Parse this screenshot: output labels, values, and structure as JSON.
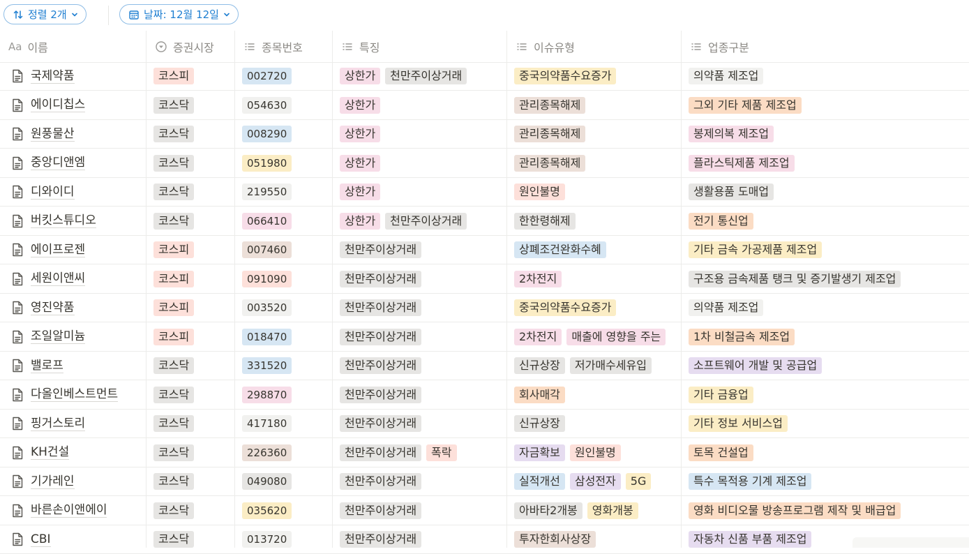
{
  "toolbar": {
    "sort_label": "정렬 2개",
    "date_label": "날짜: 12월 12일",
    "accent": "#1f7fd1",
    "sort_icon": "sort-arrows-icon",
    "date_icon": "calendar-icon"
  },
  "columns": {
    "name": "이름",
    "name_icon_text": "Aa",
    "market": "증권시장",
    "code": "종목번호",
    "feature": "특징",
    "issue": "이슈유형",
    "industry": "업종구분"
  },
  "rows": [
    {
      "name": "국제약품",
      "market": {
        "label": "코스피",
        "color": "red"
      },
      "code": {
        "label": "002720",
        "color": "blue"
      },
      "features": [
        {
          "label": "상한가",
          "color": "pink"
        },
        {
          "label": "천만주이상거래",
          "color": "gray"
        }
      ],
      "issues": [
        {
          "label": "중국의약품수요증가",
          "color": "yellow"
        }
      ],
      "industry": {
        "label": "의약품 제조업",
        "color": "default"
      }
    },
    {
      "name": "에이디칩스",
      "market": {
        "label": "코스닥",
        "color": "gray"
      },
      "code": {
        "label": "054630",
        "color": "default"
      },
      "features": [
        {
          "label": "상한가",
          "color": "pink"
        }
      ],
      "issues": [
        {
          "label": "관리종목해제",
          "color": "brown"
        }
      ],
      "industry": {
        "label": "그외 기타 제품 제조업",
        "color": "orange"
      }
    },
    {
      "name": "원풍물산",
      "market": {
        "label": "코스닥",
        "color": "gray"
      },
      "code": {
        "label": "008290",
        "color": "blue"
      },
      "features": [
        {
          "label": "상한가",
          "color": "pink"
        }
      ],
      "issues": [
        {
          "label": "관리종목해제",
          "color": "brown"
        }
      ],
      "industry": {
        "label": "봉제의복 제조업",
        "color": "pink"
      }
    },
    {
      "name": "중앙디앤엠",
      "market": {
        "label": "코스닥",
        "color": "gray"
      },
      "code": {
        "label": "051980",
        "color": "yellow"
      },
      "features": [
        {
          "label": "상한가",
          "color": "pink"
        }
      ],
      "issues": [
        {
          "label": "관리종목해제",
          "color": "brown"
        }
      ],
      "industry": {
        "label": "플라스틱제품 제조업",
        "color": "pink"
      }
    },
    {
      "name": "디와이디",
      "market": {
        "label": "코스닥",
        "color": "gray"
      },
      "code": {
        "label": "219550",
        "color": "default"
      },
      "features": [
        {
          "label": "상한가",
          "color": "pink"
        }
      ],
      "issues": [
        {
          "label": "원인불명",
          "color": "red"
        }
      ],
      "industry": {
        "label": "생활용품 도매업",
        "color": "gray"
      }
    },
    {
      "name": "버킷스튜디오",
      "market": {
        "label": "코스닥",
        "color": "gray"
      },
      "code": {
        "label": "066410",
        "color": "pink"
      },
      "features": [
        {
          "label": "상한가",
          "color": "pink"
        },
        {
          "label": "천만주이상거래",
          "color": "gray"
        }
      ],
      "issues": [
        {
          "label": "한한령해제",
          "color": "gray"
        }
      ],
      "industry": {
        "label": "전기 통신업",
        "color": "orange"
      }
    },
    {
      "name": "에이프로젠",
      "market": {
        "label": "코스피",
        "color": "red"
      },
      "code": {
        "label": "007460",
        "color": "brown"
      },
      "features": [
        {
          "label": "천만주이상거래",
          "color": "gray"
        }
      ],
      "issues": [
        {
          "label": "상폐조건완화수혜",
          "color": "blue"
        }
      ],
      "industry": {
        "label": "기타 금속 가공제품 제조업",
        "color": "yellow"
      }
    },
    {
      "name": "세원이앤씨",
      "market": {
        "label": "코스피",
        "color": "red"
      },
      "code": {
        "label": "091090",
        "color": "red"
      },
      "features": [
        {
          "label": "천만주이상거래",
          "color": "gray"
        }
      ],
      "issues": [
        {
          "label": "2차전지",
          "color": "pink"
        }
      ],
      "industry": {
        "label": "구조용 금속제품 탱크 및 증기발생기 제조업",
        "color": "gray"
      }
    },
    {
      "name": "영진약품",
      "market": {
        "label": "코스피",
        "color": "red"
      },
      "code": {
        "label": "003520",
        "color": "default"
      },
      "features": [
        {
          "label": "천만주이상거래",
          "color": "gray"
        }
      ],
      "issues": [
        {
          "label": "중국의약품수요증가",
          "color": "yellow"
        }
      ],
      "industry": {
        "label": "의약품 제조업",
        "color": "default"
      }
    },
    {
      "name": "조일알미늄",
      "market": {
        "label": "코스피",
        "color": "red"
      },
      "code": {
        "label": "018470",
        "color": "blue"
      },
      "features": [
        {
          "label": "천만주이상거래",
          "color": "gray"
        }
      ],
      "issues": [
        {
          "label": "2차전지",
          "color": "pink"
        },
        {
          "label": "매출에 영향을 주는",
          "color": "pink"
        }
      ],
      "industry": {
        "label": "1차 비철금속 제조업",
        "color": "orange"
      }
    },
    {
      "name": "밸로프",
      "market": {
        "label": "코스닥",
        "color": "gray"
      },
      "code": {
        "label": "331520",
        "color": "blue"
      },
      "features": [
        {
          "label": "천만주이상거래",
          "color": "gray"
        }
      ],
      "issues": [
        {
          "label": "신규상장",
          "color": "gray"
        },
        {
          "label": "저가매수세유입",
          "color": "gray"
        }
      ],
      "industry": {
        "label": "소프트웨어 개발 및 공급업",
        "color": "purple"
      }
    },
    {
      "name": "다올인베스트먼트",
      "market": {
        "label": "코스닥",
        "color": "gray"
      },
      "code": {
        "label": "298870",
        "color": "pink"
      },
      "features": [
        {
          "label": "천만주이상거래",
          "color": "gray"
        }
      ],
      "issues": [
        {
          "label": "회사매각",
          "color": "orange"
        }
      ],
      "industry": {
        "label": "기타 금융업",
        "color": "yellow"
      }
    },
    {
      "name": "핑거스토리",
      "market": {
        "label": "코스닥",
        "color": "gray"
      },
      "code": {
        "label": "417180",
        "color": "default"
      },
      "features": [
        {
          "label": "천만주이상거래",
          "color": "gray"
        }
      ],
      "issues": [
        {
          "label": "신규상장",
          "color": "gray"
        }
      ],
      "industry": {
        "label": "기타 정보 서비스업",
        "color": "yellow"
      }
    },
    {
      "name": "KH건설",
      "market": {
        "label": "코스닥",
        "color": "gray"
      },
      "code": {
        "label": "226360",
        "color": "brown"
      },
      "features": [
        {
          "label": "천만주이상거래",
          "color": "gray"
        },
        {
          "label": "폭락",
          "color": "red"
        }
      ],
      "issues": [
        {
          "label": "자금확보",
          "color": "purple"
        },
        {
          "label": "원인불명",
          "color": "red"
        }
      ],
      "industry": {
        "label": "토목 건설업",
        "color": "orange"
      }
    },
    {
      "name": "기가레인",
      "market": {
        "label": "코스닥",
        "color": "gray"
      },
      "code": {
        "label": "049080",
        "color": "gray"
      },
      "features": [
        {
          "label": "천만주이상거래",
          "color": "gray"
        }
      ],
      "issues": [
        {
          "label": "실적개선",
          "color": "blue"
        },
        {
          "label": "삼성전자",
          "color": "purple"
        },
        {
          "label": "5G",
          "color": "yellow"
        }
      ],
      "industry": {
        "label": "특수 목적용 기계 제조업",
        "color": "blue"
      }
    },
    {
      "name": "바른손이앤에이",
      "market": {
        "label": "코스닥",
        "color": "gray"
      },
      "code": {
        "label": "035620",
        "color": "yellow"
      },
      "features": [
        {
          "label": "천만주이상거래",
          "color": "gray"
        }
      ],
      "issues": [
        {
          "label": "아바타2개봉",
          "color": "gray"
        },
        {
          "label": "영화개봉",
          "color": "yellow"
        }
      ],
      "industry": {
        "label": "영화 비디오물 방송프로그램 제작 및 배급업",
        "color": "orange"
      }
    },
    {
      "name": "CBI",
      "market": {
        "label": "코스닥",
        "color": "gray"
      },
      "code": {
        "label": "013720",
        "color": "default"
      },
      "features": [
        {
          "label": "천만주이상거래",
          "color": "gray"
        }
      ],
      "issues": [
        {
          "label": "투자한회사상장",
          "color": "brown"
        }
      ],
      "industry": {
        "label": "자동차 신품 부품 제조업",
        "color": "purple"
      }
    }
  ]
}
